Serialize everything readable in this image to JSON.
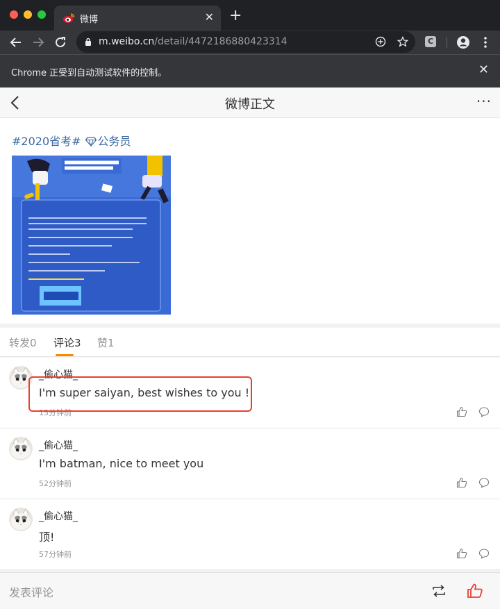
{
  "browser": {
    "tab_title": "微博",
    "tab_close": "✕",
    "new_tab": "+",
    "url_host": "m.weibo.cn",
    "url_path": "/detail/4472186880423314",
    "extension_label": "C",
    "infobar_text": "Chrome 正受到自动测试软件的控制。",
    "infobar_close": "✕"
  },
  "header": {
    "title": "微博正文",
    "more": "···"
  },
  "post": {
    "hashtag": "#2020省考#",
    "topic": "公务员"
  },
  "tabs": [
    {
      "label": "转发0"
    },
    {
      "label": "评论3"
    },
    {
      "label": "赞1"
    }
  ],
  "comments": [
    {
      "user": "_偷心猫_",
      "text": "I'm super saiyan, best wishes to you !",
      "time": "15分钟前"
    },
    {
      "user": "_偷心猫_",
      "text": "I'm batman, nice to meet you",
      "time": "52分钟前"
    },
    {
      "user": "_偷心猫_",
      "text": "顶!",
      "time": "57分钟前"
    }
  ],
  "footer": {
    "comment_placeholder": "发表评论"
  },
  "colors": {
    "link": "#3b6aa3",
    "accent": "#f58a00",
    "highlight": "#e8402c",
    "like_active": "#e8402c"
  }
}
